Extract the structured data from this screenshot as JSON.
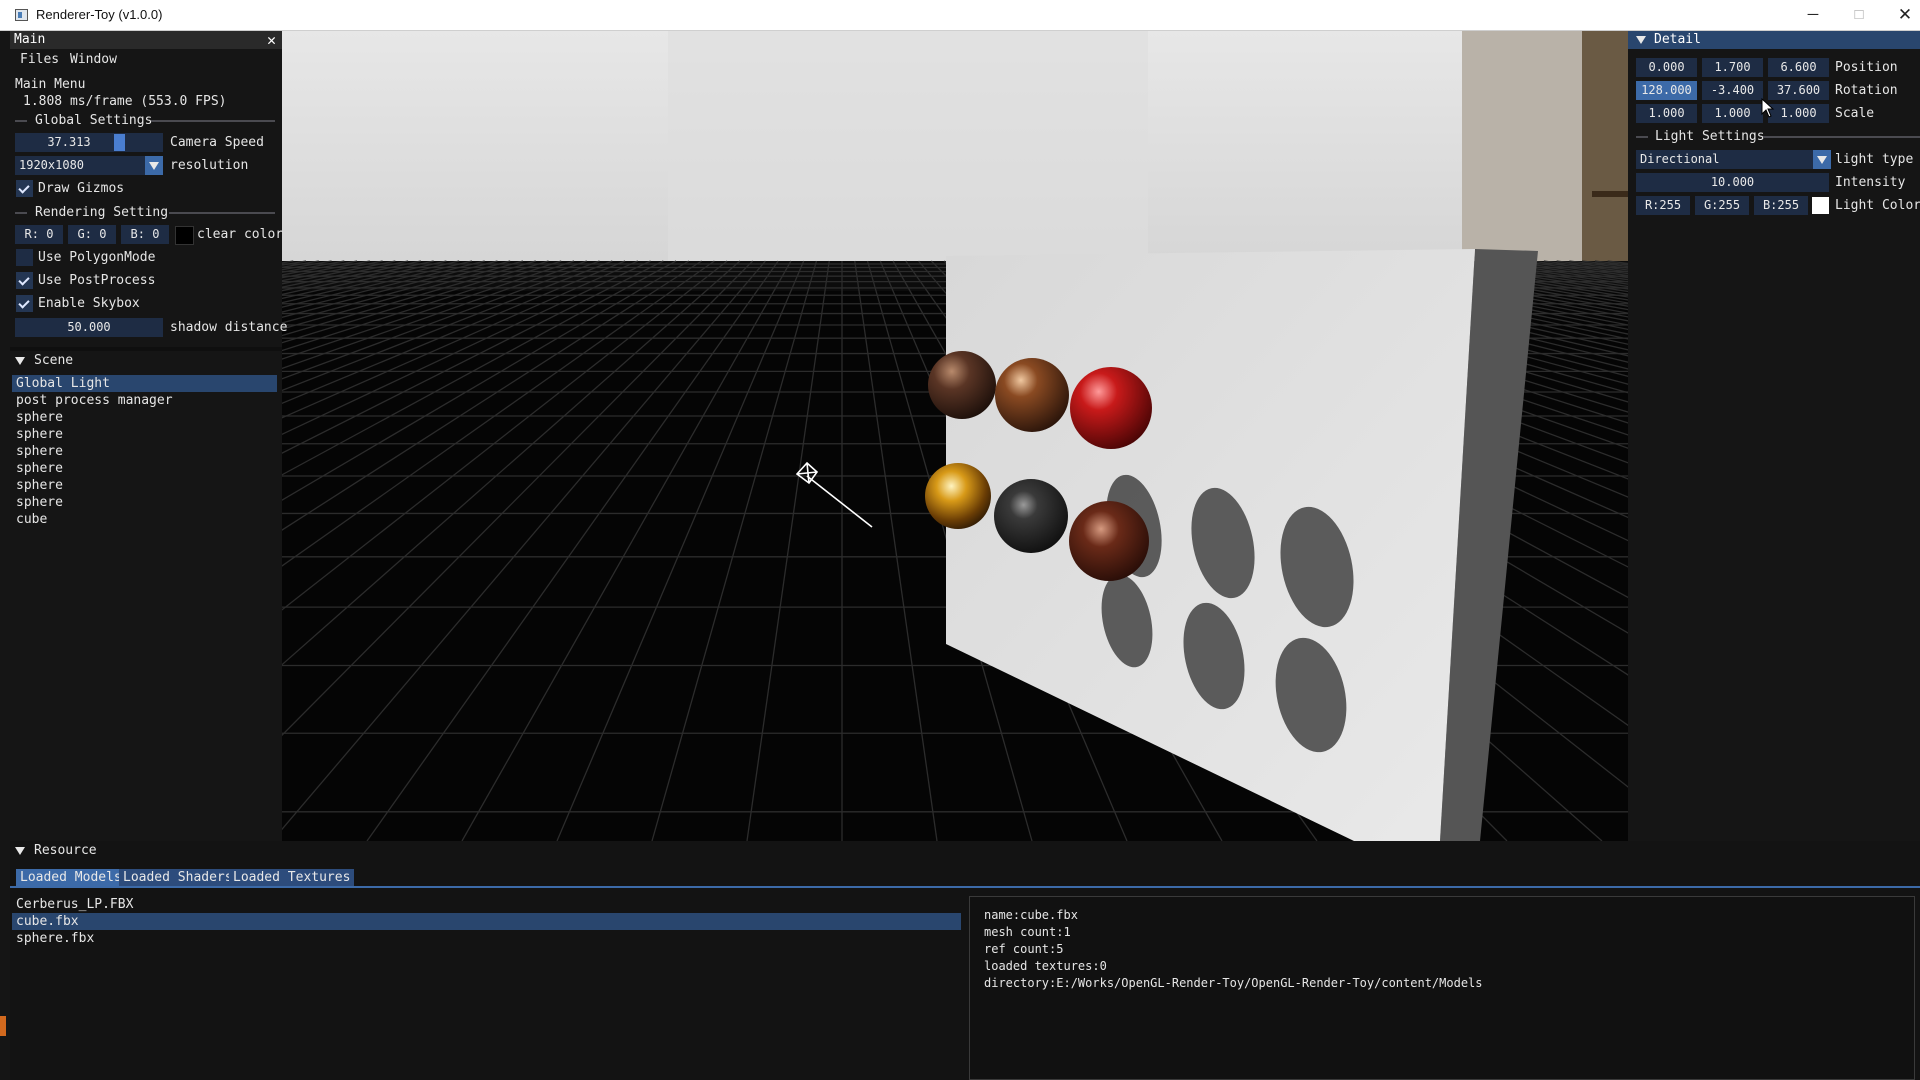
{
  "window": {
    "title": "Renderer-Toy (v1.0.0)",
    "minimize_glyph": "─",
    "maximize_glyph": "□",
    "close_glyph": "✕"
  },
  "main_panel": {
    "title": "Main",
    "close_glyph": "✕",
    "menu": [
      "Files",
      "Window"
    ],
    "menu_header": "Main Menu",
    "fps_text": "1.808 ms/frame (553.0 FPS)",
    "global_settings": {
      "title": "Global Settings",
      "camera_speed_value": "37.313",
      "camera_speed_fraction": 0.72,
      "camera_speed_label": "Camera Speed",
      "resolution_value": "1920x1080",
      "resolution_label": "resolution",
      "draw_gizmos_label": "Draw Gizmos",
      "draw_gizmos_checked": true
    },
    "rendering_setting": {
      "title": "Rendering Setting",
      "clear_r": "R:  0",
      "clear_g": "G:  0",
      "clear_b": "B:  0",
      "clear_color_label": "clear color",
      "clear_color": "#000000",
      "polygon_mode_label": "Use PolygonMode",
      "polygon_mode_checked": false,
      "post_process_label": "Use PostProcess",
      "post_process_checked": true,
      "skybox_label": "Enable Skybox",
      "skybox_checked": true,
      "shadow_distance_value": "50.000",
      "shadow_distance_label": "shadow distance"
    }
  },
  "scene_panel": {
    "title": "Scene",
    "items": [
      "Global Light",
      "post process manager",
      "sphere",
      "sphere",
      "sphere",
      "sphere",
      "sphere",
      "sphere",
      "cube"
    ],
    "selected_index": 0
  },
  "detail_panel": {
    "title": "Detail",
    "position": [
      "0.000",
      "1.700",
      "6.600"
    ],
    "position_label": "Position",
    "rotation": [
      "128.000",
      "-3.400",
      "37.600"
    ],
    "rotation_label": "Rotation",
    "scale": [
      "1.000",
      "1.000",
      "1.000"
    ],
    "scale_label": "Scale",
    "light_settings_title": "Light Settings",
    "light_type_value": "Directional",
    "light_type_label": "light type",
    "intensity_value": "10.000",
    "intensity_label": "Intensity",
    "light_r": "R:255",
    "light_g": "G:255",
    "light_b": "B:255",
    "light_color_label": "Light Color",
    "light_color": "#ffffff"
  },
  "resource_panel": {
    "title": "Resource",
    "tabs": [
      "Loaded Models",
      "Loaded Shaders",
      "Loaded Textures"
    ],
    "active_tab": 0,
    "models": [
      "Cerberus_LP.FBX",
      "cube.fbx",
      "sphere.fbx"
    ],
    "selected_model": 1,
    "info": [
      "name:cube.fbx",
      "mesh count:1",
      "ref count:5",
      "loaded textures:0",
      "directory:E:/Works/OpenGL-Render-Toy/OpenGL-Render-Toy/content/Models"
    ]
  },
  "colors": {
    "header_blue": "#29466e",
    "field_blue": "#1e2c44",
    "accent_blue": "#3c6aa8",
    "panel_bg": "#151515"
  },
  "icons": [
    "app-icon",
    "close-icon",
    "collapse-triangle-icon",
    "dropdown-arrow-icon",
    "checkmark-icon",
    "light-gizmo-icon"
  ]
}
